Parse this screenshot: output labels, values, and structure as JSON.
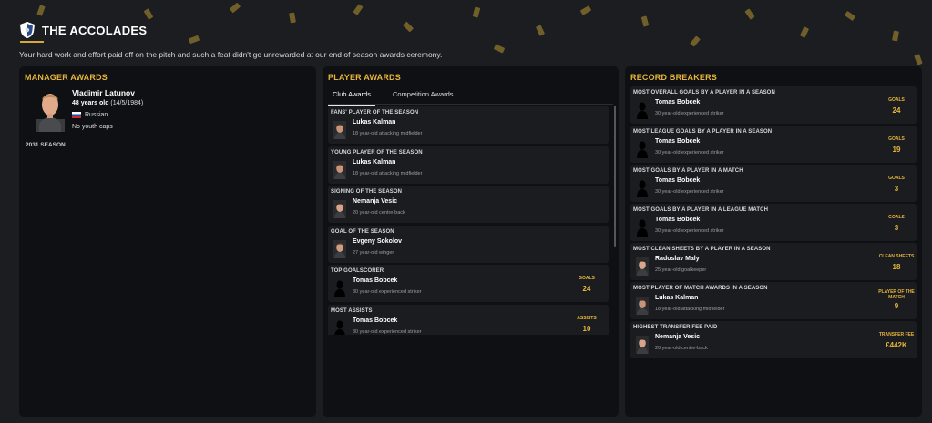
{
  "header": {
    "title": "THE ACCOLADES",
    "subtitle": "Your hard work and effort paid off on the pitch and such a feat didn't go unrewarded at our end of season awards ceremony."
  },
  "manager_awards": {
    "title": "MANAGER AWARDS",
    "name": "Vladimir Latunov",
    "age_bold": "48 years old",
    "age_date": "(14/5/1984)",
    "nationality": "Russian",
    "youth_caps": "No youth caps",
    "season": "2031 SEASON"
  },
  "player_awards": {
    "title": "PLAYER AWARDS",
    "tabs": [
      {
        "label": "Club Awards",
        "active": true
      },
      {
        "label": "Competition Awards",
        "active": false
      }
    ],
    "awards": [
      {
        "title": "FANS' PLAYER OF THE SEASON",
        "name": "Lukas Kalman",
        "desc": "18 year-old attacking midfielder",
        "stat_label": "",
        "stat_value": ""
      },
      {
        "title": "YOUNG PLAYER OF THE SEASON",
        "name": "Lukas Kalman",
        "desc": "18 year-old attacking midfielder",
        "stat_label": "",
        "stat_value": ""
      },
      {
        "title": "SIGNING OF THE SEASON",
        "name": "Nemanja Vesic",
        "desc": "20 year-old centre-back",
        "stat_label": "",
        "stat_value": ""
      },
      {
        "title": "GOAL OF THE SEASON",
        "name": "Evgeny Sokolov",
        "desc": "27 year-old winger",
        "stat_label": "",
        "stat_value": ""
      },
      {
        "title": "TOP GOALSCORER",
        "name": "Tomas Bobcek",
        "desc": "30 year-old experienced striker",
        "stat_label": "GOALS",
        "stat_value": "24"
      },
      {
        "title": "MOST ASSISTS",
        "name": "Tomas Bobcek",
        "desc": "30 year-old experienced striker",
        "stat_label": "ASSISTS",
        "stat_value": "10"
      }
    ]
  },
  "record_breakers": {
    "title": "RECORD BREAKERS",
    "records": [
      {
        "title": "MOST OVERALL GOALS BY A PLAYER IN A SEASON",
        "name": "Tomas Bobcek",
        "desc": "30 year-old experienced striker",
        "stat_label": "GOALS",
        "stat_value": "24"
      },
      {
        "title": "MOST LEAGUE GOALS BY A PLAYER IN A SEASON",
        "name": "Tomas Bobcek",
        "desc": "30 year-old experienced striker",
        "stat_label": "GOALS",
        "stat_value": "19"
      },
      {
        "title": "MOST GOALS BY A PLAYER IN A MATCH",
        "name": "Tomas Bobcek",
        "desc": "30 year-old experienced striker",
        "stat_label": "GOALS",
        "stat_value": "3"
      },
      {
        "title": "MOST GOALS BY A PLAYER IN A LEAGUE MATCH",
        "name": "Tomas Bobcek",
        "desc": "30 year-old experienced striker",
        "stat_label": "GOALS",
        "stat_value": "3"
      },
      {
        "title": "MOST CLEAN SHEETS BY A PLAYER IN A SEASON",
        "name": "Radoslav Maly",
        "desc": "25 year-old goalkeeper",
        "stat_label": "CLEAN SHEETS",
        "stat_value": "18"
      },
      {
        "title": "MOST PLAYER OF MATCH AWARDS IN A SEASON",
        "name": "Lukas Kalman",
        "desc": "18 year-old attacking midfielder",
        "stat_label": "PLAYER OF THE MATCH",
        "stat_value": "9"
      },
      {
        "title": "HIGHEST TRANSFER FEE PAID",
        "name": "Nemanja Vesic",
        "desc": "20 year-old centre-back",
        "stat_label": "TRANSFER FEE",
        "stat_value": "£442K"
      }
    ]
  },
  "colors": {
    "accent": "#e6b53a",
    "panel": "#0f1013",
    "card": "#1b1c20",
    "background": "#1c1d20"
  }
}
